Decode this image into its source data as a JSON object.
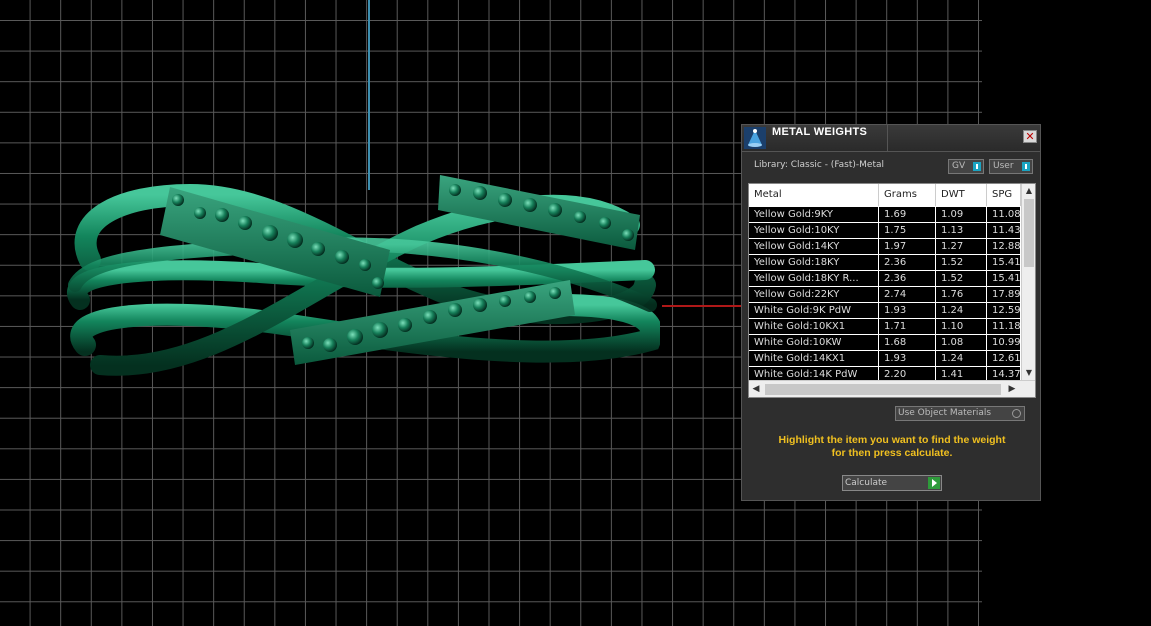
{
  "panel": {
    "title": "METAL WEIGHTS",
    "close_glyph": "✕",
    "library_label": "Library: Classic - (Fast)-Metal",
    "toggle_gv": "GV",
    "toggle_user": "User",
    "use_object_materials": "Use Object Materials",
    "hint_line1": "Highlight the item you want to find the weight",
    "hint_line2": "for then press calculate.",
    "calculate_label": "Calculate",
    "accent_color": "#1aa4c2",
    "hint_color": "#f0c020",
    "icons": [
      "metal-weights-logo-icon",
      "close-icon",
      "scroll-up-icon",
      "scroll-down-icon",
      "scroll-left-icon",
      "scroll-right-icon",
      "play-icon"
    ]
  },
  "table": {
    "headers": [
      "Metal",
      "Grams",
      "DWT",
      "SPG"
    ],
    "rows": [
      [
        "Yellow Gold:9KY",
        "1.69",
        "1.09",
        "11.08"
      ],
      [
        "Yellow Gold:10KY",
        "1.75",
        "1.13",
        "11.43"
      ],
      [
        "Yellow Gold:14KY",
        "1.97",
        "1.27",
        "12.88"
      ],
      [
        "Yellow Gold:18KY",
        "2.36",
        "1.52",
        "15.41"
      ],
      [
        "Yellow Gold:18KY R...",
        "2.36",
        "1.52",
        "15.41"
      ],
      [
        "Yellow Gold:22KY",
        "2.74",
        "1.76",
        "17.89"
      ],
      [
        "White Gold:9K PdW",
        "1.93",
        "1.24",
        "12.59"
      ],
      [
        "White Gold:10KX1",
        "1.71",
        "1.10",
        "11.18"
      ],
      [
        "White Gold:10KW",
        "1.68",
        "1.08",
        "10.99"
      ],
      [
        "White Gold:14KX1",
        "1.93",
        "1.24",
        "12.61"
      ],
      [
        "White Gold:14K PdW",
        "2.20",
        "1.41",
        "14.37"
      ]
    ]
  },
  "viewport": {
    "model_color": "#0f7a55",
    "axis_colors": {
      "vertical": "#3d8fb0",
      "horizontal": "#b01818"
    }
  }
}
